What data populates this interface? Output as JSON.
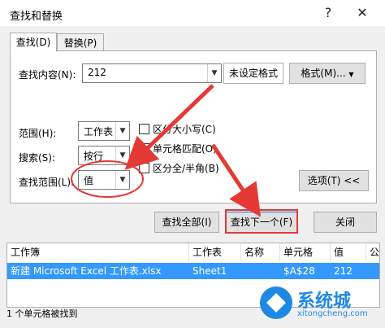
{
  "window": {
    "title": "查找和替换",
    "help": "?",
    "close": "✕"
  },
  "tabs": [
    {
      "label": "查找(D)"
    },
    {
      "label": "替换(P)"
    }
  ],
  "find": {
    "label": "查找内容(N):",
    "value": "212",
    "format_status": "未设定格式",
    "format_button": "格式(M)..."
  },
  "options": {
    "scope": {
      "label": "范围(H):",
      "value": "工作表"
    },
    "search": {
      "label": "搜索(S):",
      "value": "按行"
    },
    "look_in": {
      "label": "查找范围(L):",
      "value": "值"
    },
    "match_case": "区分大小写(C)",
    "match_cell": "单元格匹配(O)",
    "match_width": "区分全/半角(B)",
    "options_button": "选项(T) <<"
  },
  "actions": {
    "find_all": "查找全部(I)",
    "find_next": "查找下一个(F)",
    "close": "关闭"
  },
  "results": {
    "headers": [
      "工作簿",
      "工作表",
      "名称",
      "单元格",
      "值",
      "公"
    ],
    "rows": [
      {
        "workbook": "新建 Microsoft Excel 工作表.xlsx",
        "sheet": "Sheet1",
        "name": "",
        "cell": "$A$28",
        "value": "212"
      }
    ]
  },
  "status": "1 个单元格被找到",
  "watermark": {
    "brand": "系统城",
    "site": "xitongcheng.com"
  },
  "colors": {
    "annotation": "#e53935",
    "selection": "#3399ff",
    "primary_border": "#0078d7"
  }
}
